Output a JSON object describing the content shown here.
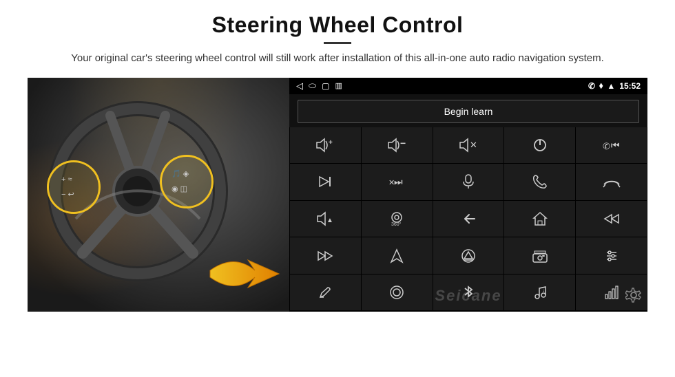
{
  "header": {
    "title": "Steering Wheel Control",
    "subtitle": "Your original car's steering wheel control will still work after installation of this all-in-one auto radio navigation system."
  },
  "statusBar": {
    "backArrow": "◁",
    "homeOval": "⬭",
    "squareRecent": "▢",
    "batterySignal": "▥▐",
    "phoneIcon": "✆",
    "locationIcon": "⬧",
    "wifiIcon": "▲",
    "time": "15:52"
  },
  "beginLearnBtn": "Begin learn",
  "gridIcons": [
    {
      "icon": "🔊+",
      "label": "vol-up"
    },
    {
      "icon": "🔊-",
      "label": "vol-down"
    },
    {
      "icon": "🔇",
      "label": "mute"
    },
    {
      "icon": "⏻",
      "label": "power"
    },
    {
      "icon": "⏮",
      "label": "prev-track-phone"
    },
    {
      "icon": "⏭",
      "label": "next-track"
    },
    {
      "icon": "⏪×",
      "label": "seek-back"
    },
    {
      "icon": "🎙",
      "label": "mic"
    },
    {
      "icon": "📞",
      "label": "call"
    },
    {
      "icon": "📵",
      "label": "end-call"
    },
    {
      "icon": "📢",
      "label": "horn"
    },
    {
      "icon": "360°",
      "label": "camera-360"
    },
    {
      "icon": "↩",
      "label": "back"
    },
    {
      "icon": "🏠",
      "label": "home"
    },
    {
      "icon": "⏮⏮",
      "label": "rewind"
    },
    {
      "icon": "⏭⏭",
      "label": "fast-forward"
    },
    {
      "icon": "▶",
      "label": "navigate"
    },
    {
      "icon": "⊜",
      "label": "eject"
    },
    {
      "icon": "📻",
      "label": "radio"
    },
    {
      "icon": "⚙",
      "label": "eq-settings"
    },
    {
      "icon": "✏",
      "label": "write"
    },
    {
      "icon": "⬤",
      "label": "record"
    },
    {
      "icon": "✦",
      "label": "bluetooth"
    },
    {
      "icon": "♪",
      "label": "music"
    },
    {
      "icon": "📶",
      "label": "signal"
    }
  ],
  "watermark": "Seicane",
  "colors": {
    "accent": "#f0c020",
    "panelBg": "#111111",
    "statusBg": "#000000",
    "cellBg": "#1c1c1c",
    "textLight": "#cccccc"
  }
}
